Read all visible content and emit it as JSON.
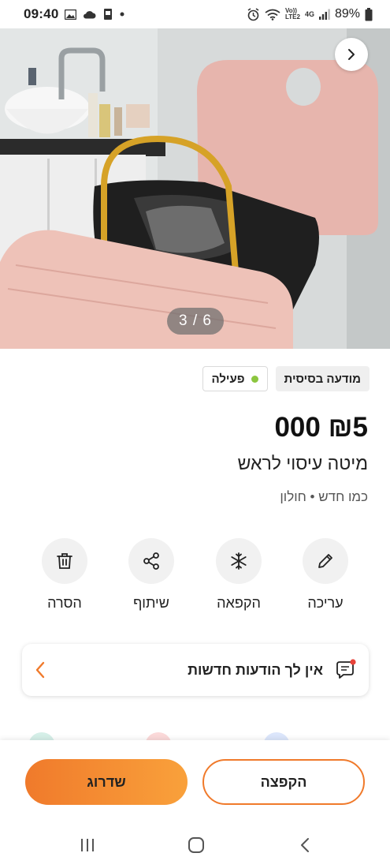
{
  "status_bar": {
    "time": "09:40",
    "network_top": "Vo))",
    "network_bottom": "LTE2",
    "network_type": "4G",
    "battery": "89%"
  },
  "gallery": {
    "counter": "3 / 6",
    "next_icon": "chevron-right-icon"
  },
  "badges": {
    "type": "מודעה בסיסית",
    "status": "פעילה",
    "status_color": "#8cc63f"
  },
  "listing": {
    "price": "₪5 000",
    "title": "מיטה עיסוי לראש",
    "subtitle": "כמו חדש • חולון"
  },
  "actions": [
    {
      "label": "עריכה",
      "icon": "pencil-icon"
    },
    {
      "label": "הקפאה",
      "icon": "snowflake-icon"
    },
    {
      "label": "שיתוף",
      "icon": "share-icon"
    },
    {
      "label": "הסרה",
      "icon": "trash-icon"
    }
  ],
  "messages": {
    "text": "אין לך הודעות חדשות",
    "icon": "chat-icon",
    "chevron": "chevron-left-icon"
  },
  "bottom": {
    "skip_label": "הקפצה",
    "upgrade_label": "שדרוג",
    "accent_color": "#f07a2b"
  },
  "nav": {
    "recents": "recents-icon",
    "home": "home-icon",
    "back": "back-icon"
  }
}
